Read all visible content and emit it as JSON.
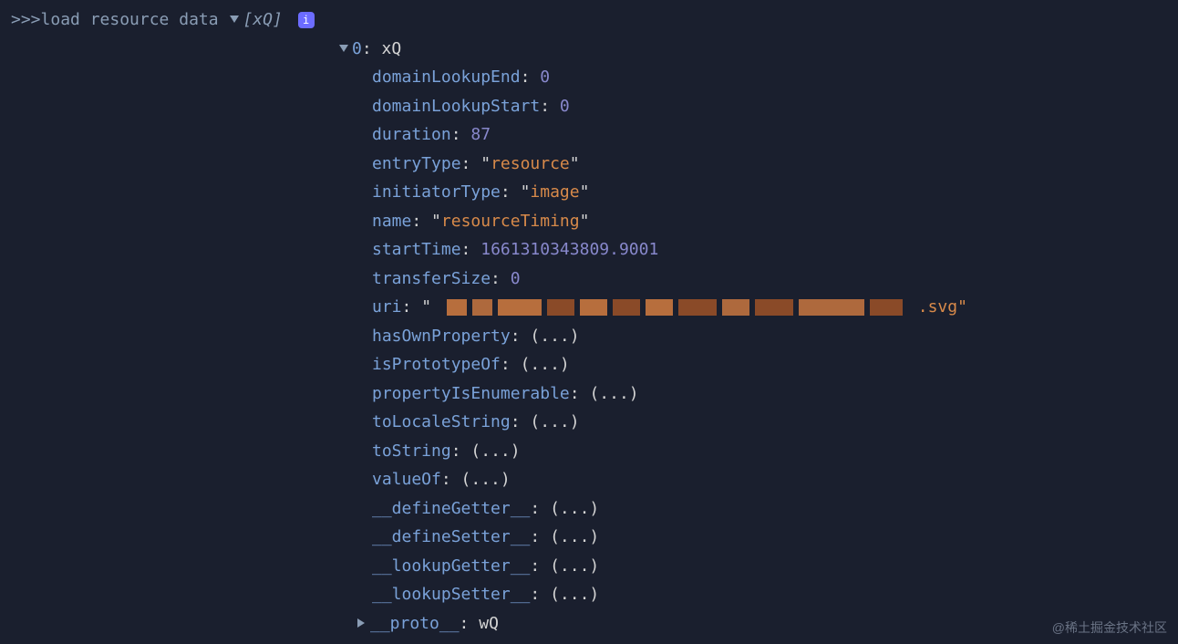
{
  "prompt": ">>>",
  "command": "load resource data",
  "summary": "[xQ]",
  "infoBadge": "i",
  "entry0": {
    "index": "0",
    "type": "xQ"
  },
  "props": {
    "domainLookupEnd": {
      "key": "domainLookupEnd",
      "value": "0",
      "kind": "num"
    },
    "domainLookupStart": {
      "key": "domainLookupStart",
      "value": "0",
      "kind": "num"
    },
    "duration": {
      "key": "duration",
      "value": "87",
      "kind": "num"
    },
    "entryType": {
      "key": "entryType",
      "value": "resource",
      "kind": "str"
    },
    "initiatorType": {
      "key": "initiatorType",
      "value": "image",
      "kind": "str"
    },
    "name": {
      "key": "name",
      "value": "resourceTiming",
      "kind": "str"
    },
    "startTime": {
      "key": "startTime",
      "value": "1661310343809.9001",
      "kind": "num"
    },
    "transferSize": {
      "key": "transferSize",
      "value": "0",
      "kind": "num"
    },
    "uri": {
      "key": "uri",
      "suffix": ".svg\""
    },
    "hasOwnProperty": {
      "key": "hasOwnProperty",
      "value": "(...)"
    },
    "isPrototypeOf": {
      "key": "isPrototypeOf",
      "value": "(...)"
    },
    "propertyIsEnumerable": {
      "key": "propertyIsEnumerable",
      "value": "(...)"
    },
    "toLocaleString": {
      "key": "toLocaleString",
      "value": "(...)"
    },
    "toString": {
      "key": "toString",
      "value": "(...)"
    },
    "valueOf": {
      "key": "valueOf",
      "value": "(...)"
    },
    "defineGetter": {
      "key": "__defineGetter__",
      "value": "(...)"
    },
    "defineSetter": {
      "key": "__defineSetter__",
      "value": "(...)"
    },
    "lookupGetter": {
      "key": "__lookupGetter__",
      "value": "(...)"
    },
    "lookupSetter": {
      "key": "__lookupSetter__",
      "value": "(...)"
    },
    "proto": {
      "key": "__proto__",
      "value": "wQ"
    }
  },
  "watermark": "@稀土掘金技术社区"
}
